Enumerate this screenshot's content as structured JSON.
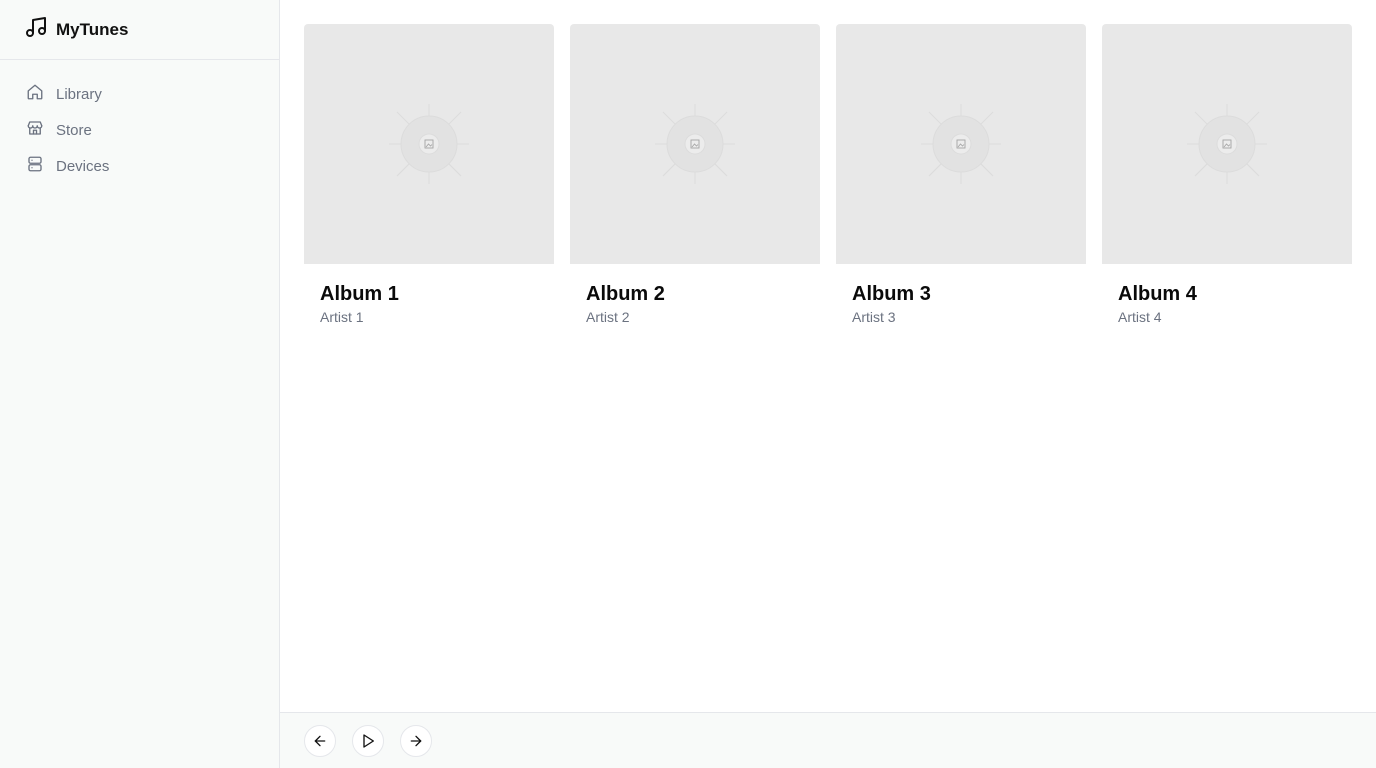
{
  "app": {
    "name": "MyTunes",
    "icon": "music-note-icon"
  },
  "sidebar": {
    "items": [
      {
        "label": "Library",
        "icon": "home-icon"
      },
      {
        "label": "Store",
        "icon": "store-icon"
      },
      {
        "label": "Devices",
        "icon": "server-icon"
      }
    ]
  },
  "albums": [
    {
      "title": "Album 1",
      "artist": "Artist 1"
    },
    {
      "title": "Album 2",
      "artist": "Artist 2"
    },
    {
      "title": "Album 3",
      "artist": "Artist 3"
    },
    {
      "title": "Album 4",
      "artist": "Artist 4"
    }
  ],
  "player": {
    "controls": [
      {
        "icon": "arrow-left-icon"
      },
      {
        "icon": "play-icon"
      },
      {
        "icon": "arrow-right-icon"
      }
    ]
  },
  "colors": {
    "sidebar_bg": "#f8faf9",
    "cover_bg": "#e8e8e8",
    "muted_text": "#6b7280",
    "border": "#e5e7eb"
  }
}
